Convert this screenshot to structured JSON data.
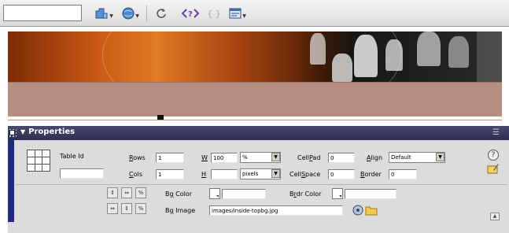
{
  "toolbar": {
    "icons": [
      "file-management-icon",
      "preview-browser-icon",
      "refresh-icon",
      "code-navigation-icon",
      "braces-icon",
      "view-options-icon"
    ]
  },
  "panel": {
    "title": "Properties",
    "table_id_label": "Table Id",
    "table_id_value": "",
    "rows_label_u": "R",
    "rows_label_rest": "ows",
    "rows_value": "1",
    "cols_label_u": "C",
    "cols_label_rest": "ols",
    "cols_value": "1",
    "w_label": "W",
    "w_value": "100",
    "w_unit": "%",
    "h_label": "H",
    "h_value": "",
    "h_unit": "pixels",
    "cellpad_label_a": "Cell",
    "cellpad_label_u": "P",
    "cellpad_label_b": "ad",
    "cellpad_value": "0",
    "cellspace_label_a": "Cell",
    "cellspace_label_u": "S",
    "cellspace_label_b": "pace",
    "cellspace_value": "0",
    "align_label_u": "A",
    "align_label_rest": "lign",
    "align_value": "Default",
    "border_label_u": "B",
    "border_label_rest": "order",
    "border_value": "0",
    "bgcolor_label_a": "B",
    "bgcolor_label_u": "g",
    "bgcolor_label_b": " Color",
    "brdr_color_label_a": "B",
    "brdr_color_label_u": "r",
    "brdr_color_label_b": "dr Color",
    "bgcolor_value": "",
    "brdr_color_value": "",
    "bgimage_label_a": "B",
    "bgimage_label_u": "g",
    "bgimage_label_b": " Image",
    "bgimage_value": "images/inside-topbg.jpg"
  },
  "colors": {
    "panel_bg": "#dcdcdc",
    "header_bg": "#3a3a5e",
    "left_bar": "#1e2a80",
    "body_panel": "#b88e80"
  }
}
